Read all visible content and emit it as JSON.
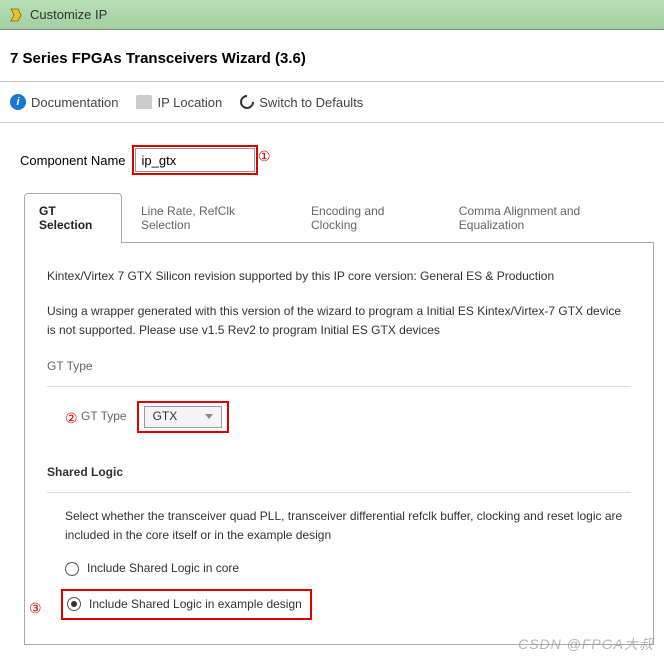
{
  "window": {
    "title": "Customize IP"
  },
  "wizard": {
    "title": "7 Series FPGAs Transceivers Wizard (3.6)"
  },
  "toolbar": {
    "documentation": "Documentation",
    "ip_location": "IP Location",
    "switch_defaults": "Switch to Defaults"
  },
  "component": {
    "label": "Component Name",
    "value": "ip_gtx"
  },
  "annotations": {
    "one": "①",
    "two": "②",
    "three": "③"
  },
  "tabs": {
    "gt_selection": "GT Selection",
    "line_rate": "Line Rate, RefClk Selection",
    "encoding": "Encoding and Clocking",
    "comma": "Comma Alignment and Equalization"
  },
  "panel": {
    "support_text": "Kintex/Virtex 7 GTX Silicon revision supported by this IP core version: General ES & Production",
    "wrapper_text": "Using a wrapper generated with this version of the wizard to program a Initial ES Kintex/Virtex-7 GTX device is not supported. Please use v1.5 Rev2 to program Initial ES GTX devices",
    "gt_type_section": "GT Type",
    "gt_type_label": "GT Type",
    "gt_type_value": "GTX",
    "shared_logic_title": "Shared Logic",
    "shared_logic_desc": "Select whether the transceiver quad PLL, transceiver differential refclk buffer, clocking and reset logic are included in the core itself or in the example design",
    "radio_in_core": "Include Shared Logic in core",
    "radio_in_example": "Include Shared Logic in example design"
  },
  "watermark": "CSDN @FPGA大叔"
}
